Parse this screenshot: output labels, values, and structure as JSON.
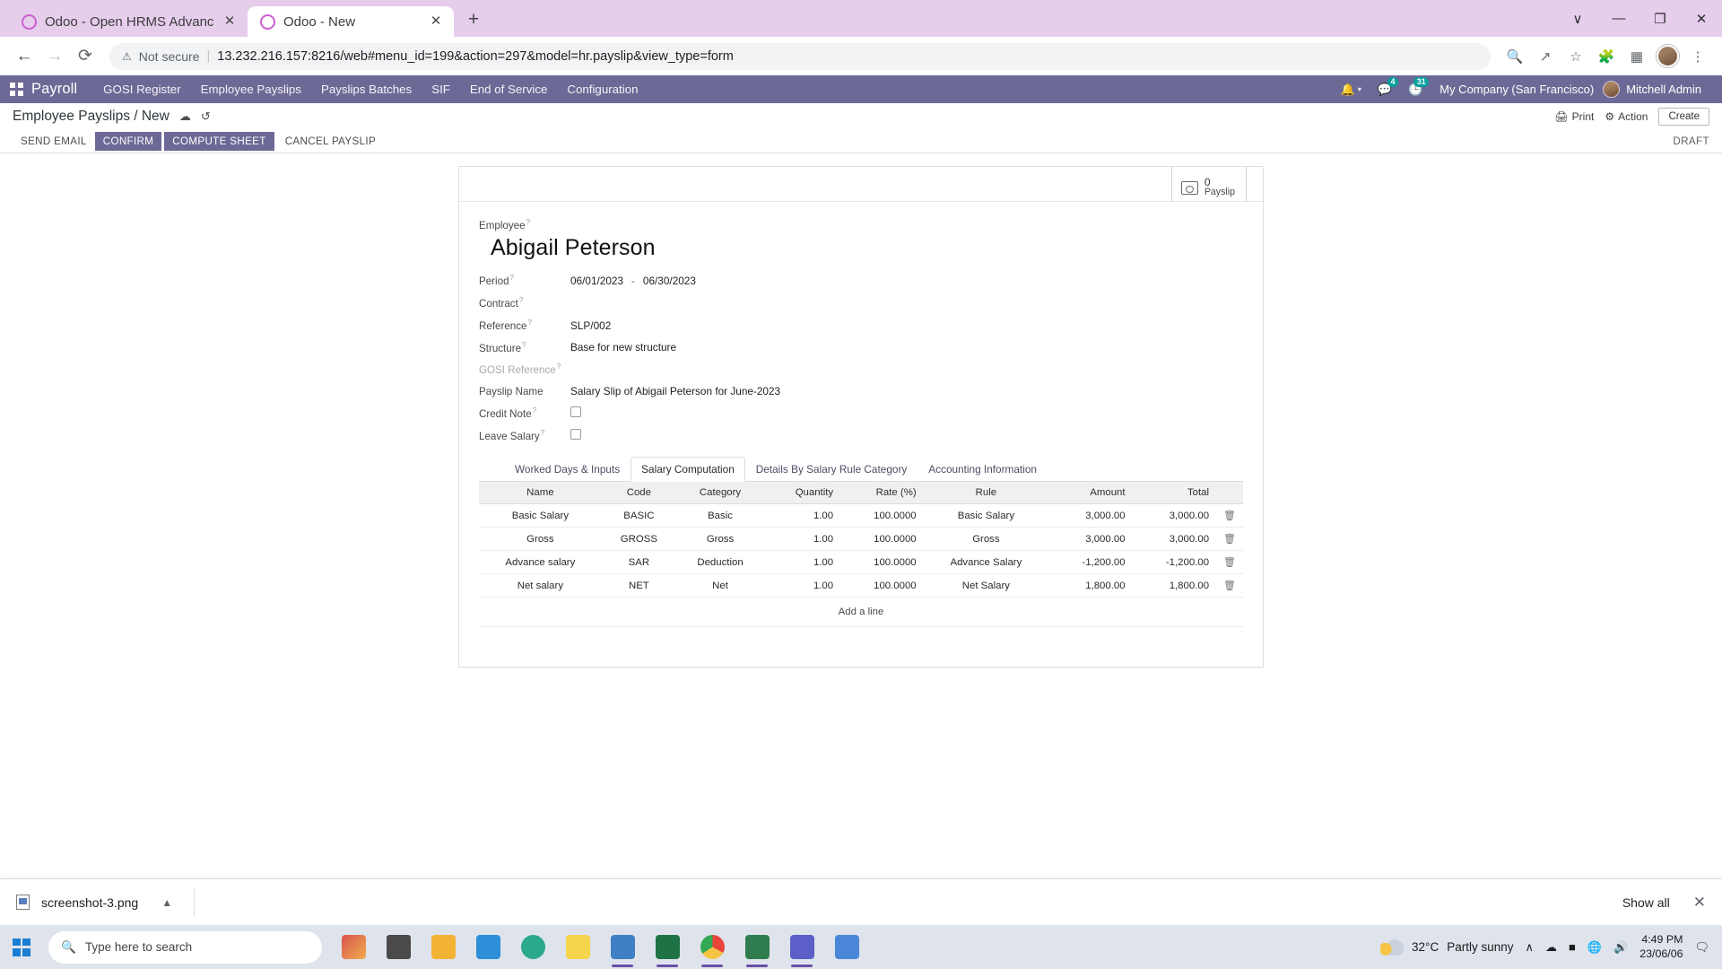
{
  "browser": {
    "tabs": [
      {
        "title": "Odoo - Open HRMS Advance Sal",
        "favicon": "odoo-favicon",
        "active": false
      },
      {
        "title": "Odoo - New",
        "favicon": "odoo-favicon",
        "active": true
      }
    ],
    "new_tab_label": "+",
    "window_controls": {
      "minimize": "—",
      "maximize": "❐",
      "close": "✕",
      "chevron": "∨"
    },
    "nav": {
      "back": "←",
      "forward": "→",
      "reload": "⟳"
    },
    "omnibox": {
      "warning_icon": "⚠",
      "security_label": "Not secure",
      "separator": "|",
      "url": "13.232.216.157:8216/web#menu_id=199&action=297&model=hr.payslip&view_type=form"
    },
    "toolbar_icons": [
      "zoom-icon",
      "share-icon",
      "bookmark-star-icon",
      "extensions-icon",
      "sidepanel-icon",
      "profile-avatar",
      "menu-kebab-icon"
    ]
  },
  "odoo": {
    "app_name": "Payroll",
    "menu_items": [
      {
        "label": "GOSI Register"
      },
      {
        "label": "Employee Payslips"
      },
      {
        "label": "Payslips Batches"
      },
      {
        "label": "SIF"
      },
      {
        "label": "End of Service"
      },
      {
        "label": "Configuration"
      }
    ],
    "systray": {
      "bell_icon": "🔔",
      "messages_count": "4",
      "activities_count": "31",
      "company": "My Company (San Francisco)",
      "user": "Mitchell Admin"
    },
    "control_panel": {
      "breadcrumb": "Employee Payslips / New",
      "cloud_icon": "cloud-save-icon",
      "discard_icon": "discard-icon",
      "print_label": "Print",
      "action_label": "Action",
      "create_label": "Create"
    },
    "statusbar": {
      "buttons": [
        {
          "label": "SEND EMAIL",
          "primary": false
        },
        {
          "label": "CONFIRM",
          "primary": true
        },
        {
          "label": "COMPUTE SHEET",
          "primary": true
        },
        {
          "label": "CANCEL PAYSLIP",
          "primary": false
        }
      ],
      "state": "DRAFT"
    },
    "stat_button": {
      "value": "0",
      "label": "Payslip",
      "icon": "money-icon"
    },
    "form": {
      "employee_label": "Employee",
      "employee_value": "Abigail Peterson",
      "fields": [
        {
          "label": "Period",
          "value": "06/01/2023",
          "value2": "06/30/2023",
          "separator": "-",
          "type": "daterange",
          "muted": false,
          "help": true
        },
        {
          "label": "Contract",
          "value": "",
          "type": "text",
          "muted": false,
          "help": true
        },
        {
          "label": "Reference",
          "value": "SLP/002",
          "type": "text",
          "muted": false,
          "help": true
        },
        {
          "label": "Structure",
          "value": "Base for new structure",
          "type": "text",
          "muted": false,
          "help": true
        },
        {
          "label": "GOSI Reference",
          "value": "",
          "type": "text",
          "muted": true,
          "help": true
        },
        {
          "label": "Payslip Name",
          "value": "Salary Slip of Abigail Peterson for June-2023",
          "type": "text",
          "muted": false,
          "help": false
        },
        {
          "label": "Credit Note",
          "value": "",
          "type": "checkbox",
          "checked": false,
          "muted": false,
          "help": true
        },
        {
          "label": "Leave Salary",
          "value": "",
          "type": "checkbox",
          "checked": false,
          "muted": false,
          "help": true
        }
      ],
      "tabs": [
        {
          "label": "Worked Days & Inputs",
          "active": false
        },
        {
          "label": "Salary Computation",
          "active": true
        },
        {
          "label": "Details By Salary Rule Category",
          "active": false
        },
        {
          "label": "Accounting Information",
          "active": false
        }
      ],
      "table": {
        "columns": [
          "Name",
          "Code",
          "Category",
          "Quantity",
          "Rate (%)",
          "Rule",
          "Amount",
          "Total"
        ],
        "rows": [
          {
            "name": "Basic Salary",
            "code": "BASIC",
            "category": "Basic",
            "quantity": "1.00",
            "rate": "100.0000",
            "rule": "Basic Salary",
            "amount": "3,000.00",
            "total": "3,000.00"
          },
          {
            "name": "Gross",
            "code": "GROSS",
            "category": "Gross",
            "quantity": "1.00",
            "rate": "100.0000",
            "rule": "Gross",
            "amount": "3,000.00",
            "total": "3,000.00"
          },
          {
            "name": "Advance salary",
            "code": "SAR",
            "category": "Deduction",
            "quantity": "1.00",
            "rate": "100.0000",
            "rule": "Advance Salary",
            "amount": "-1,200.00",
            "total": "-1,200.00"
          },
          {
            "name": "Net salary",
            "code": "NET",
            "category": "Net",
            "quantity": "1.00",
            "rate": "100.0000",
            "rule": "Net Salary",
            "amount": "1,800.00",
            "total": "1,800.00"
          }
        ],
        "add_line_label": "Add a line",
        "delete_icon": "trash-icon"
      }
    }
  },
  "download_bar": {
    "file_name": "screenshot-3.png",
    "caret_icon": "chevron-up-icon",
    "show_all_label": "Show all",
    "close_icon": "✕"
  },
  "taskbar": {
    "start_icon": "windows-logo",
    "search_placeholder": "Type here to search",
    "search_icon": "search-icon",
    "apps": [
      {
        "name": "taskview-icon",
        "color": "#4a4a4a"
      },
      {
        "name": "file-explorer-icon",
        "color": "#f2b233"
      },
      {
        "name": "microsoft-store-icon",
        "color": "#2c8fd8"
      },
      {
        "name": "browser-globe-icon",
        "color": "#2aa98c"
      },
      {
        "name": "sticky-notes-icon",
        "color": "#f6d44b"
      },
      {
        "name": "video-editor-icon",
        "color": "#3f7fc4"
      },
      {
        "name": "excel-icon",
        "color": "#1f7246"
      },
      {
        "name": "chrome-icon",
        "color": "#e8453c"
      },
      {
        "name": "terminal-icon",
        "color": "#2f7d4e"
      },
      {
        "name": "teams-icon",
        "color": "#5b5fc7"
      },
      {
        "name": "photos-icon",
        "color": "#4a87d8"
      }
    ],
    "tray": {
      "temperature": "32°C",
      "weather": "Partly sunny",
      "chevron": "∧",
      "battery_icon": "battery-icon",
      "network_icon": "network-icon",
      "volume_icon": "volume-icon",
      "time": "4:49 PM",
      "date": "23/06/06",
      "notification_icon": "notification-icon"
    }
  }
}
